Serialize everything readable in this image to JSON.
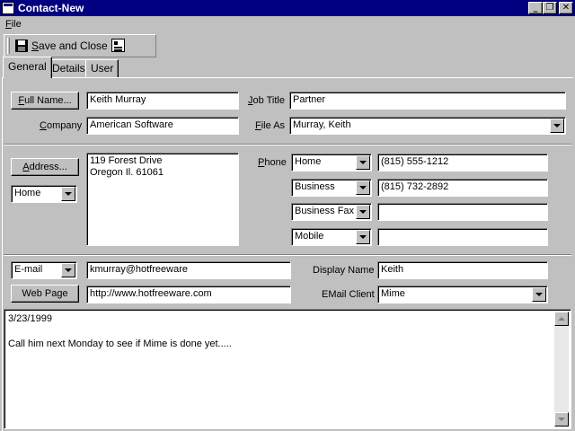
{
  "window": {
    "title": "Contact-New",
    "icon": "app-window-icon",
    "controls": {
      "minimize": "_",
      "restore": "❐",
      "close": "✕"
    }
  },
  "menu": {
    "file_ul": "F",
    "file_rest": "ile"
  },
  "toolbar": {
    "save_close_ul": "S",
    "save_close_rest": "ave and Close",
    "save_icon": "floppy-disk-icon",
    "properties_icon": "properties-icon"
  },
  "tabs": [
    {
      "label": "General",
      "active": true
    },
    {
      "label": "Details",
      "active": false
    },
    {
      "label": "User",
      "active": false
    }
  ],
  "general": {
    "full_name_button": {
      "ul": "F",
      "rest": "ull Name..."
    },
    "full_name": "Keith Murray",
    "company_label": {
      "ul": "C",
      "rest": "ompany"
    },
    "company": "American Software",
    "job_title_label": {
      "ul": "J",
      "rest": "ob Title"
    },
    "job_title": "Partner",
    "file_as_label": {
      "ul": "F",
      "rest": "ile As"
    },
    "file_as": "Murray, Keith",
    "address_button": {
      "ul": "A",
      "rest": "ddress..."
    },
    "address_type": "Home",
    "address_lines": [
      "119 Forest Drive",
      "Oregon Il. 61061"
    ],
    "phone_label": {
      "ul": "P",
      "rest": "hone"
    },
    "phones": [
      {
        "type": "Home",
        "number": "(815) 555-1212"
      },
      {
        "type": "Business",
        "number": "(815) 732-2892"
      },
      {
        "type": "Business Fax",
        "number": ""
      },
      {
        "type": "Mobile",
        "number": ""
      }
    ],
    "email_type": "E-mail",
    "email": "kmurray@hotfreeware",
    "web_page_button": "Web Page",
    "web_page": "http://www.hotfreeware.com",
    "display_name_label": "Display Name",
    "display_name": "Keith",
    "email_client_label": "EMail Client",
    "email_client": "Mime",
    "notes": [
      "3/23/1999",
      "",
      "Call him next Monday to see if Mime is done yet....."
    ]
  }
}
